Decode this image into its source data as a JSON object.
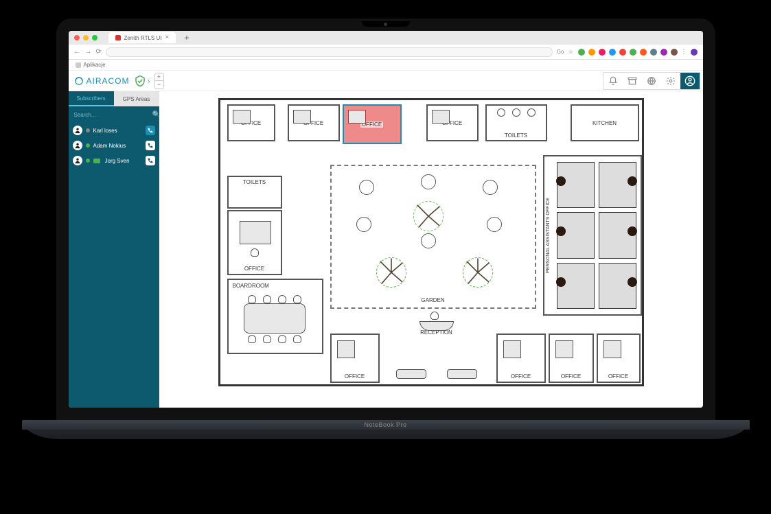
{
  "laptop_model": "NoteBook Pro",
  "browser": {
    "tab_title": "Zenith RTLS UI",
    "bookmarks_label": "Aplikacje",
    "url_share": "Go"
  },
  "app": {
    "brand": "AIRACOM",
    "header_icons": {
      "bell": "bell",
      "box": "archive",
      "globe": "globe",
      "gear": "settings",
      "profile": "profile"
    },
    "zoom": {
      "plus": "+",
      "minus": "−"
    }
  },
  "sidebar": {
    "tabs": [
      {
        "label": "Subscribers",
        "active": true
      },
      {
        "label": "GPS Areas",
        "active": false
      }
    ],
    "search_placeholder": "Search...",
    "subscribers": [
      {
        "name": "Karl loses",
        "status": "gray",
        "camera": false,
        "call_active": true
      },
      {
        "name": "Adam Nokius",
        "status": "green",
        "camera": false,
        "call_active": false
      },
      {
        "name": "Jorg Sven",
        "status": "green",
        "camera": true,
        "call_active": false
      }
    ]
  },
  "floorplan": {
    "rooms": {
      "office_top_1": "OFFICE",
      "office_top_2": "OFFICE",
      "office_top_3_highlight": "OFFICE",
      "office_top_4": "OFFICE",
      "toilets_top": "TOILETS",
      "kitchen": "KITCHEN",
      "toilets_left": "TOILETS",
      "office_left": "OFFICE",
      "boardroom": "BOARDROOM",
      "garden": "GARDEN",
      "reception": "RECEPTION",
      "pa_office": "PERSONAL ASSISTANTS OFFICE",
      "office_bottom_1": "OFFICE",
      "office_bottom_2": "OFFICE",
      "office_bottom_3": "OFFICE"
    }
  },
  "colors": {
    "brand_teal": "#0d5a6e",
    "accent_cyan": "#1a8fb5",
    "highlight_red": "#ef8a8a",
    "status_green": "#4caf50"
  }
}
